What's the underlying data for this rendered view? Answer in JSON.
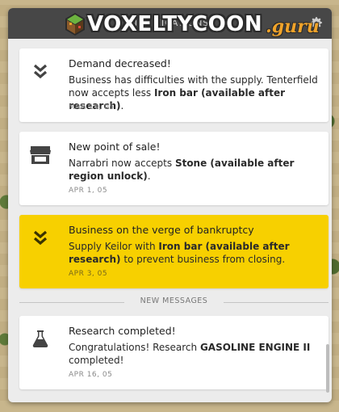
{
  "window": {
    "title": "NOTIFICATIONS",
    "settings_icon": "gear-icon"
  },
  "logo": {
    "main": "VOXELTYCOON",
    "suffix": ".guru"
  },
  "notifications": [
    {
      "icon": "double-chevron-down-icon",
      "heading": "Demand decreased!",
      "body_prefix": "Business has difficulties with the supply. Tenterfield now accepts less ",
      "body_bold": "Iron bar (available after research)",
      "body_suffix": ".",
      "date": "MAR 14, 05",
      "highlighted": false
    },
    {
      "icon": "store-icon",
      "heading": "New point of sale!",
      "body_prefix": "Narrabri now accepts ",
      "body_bold": "Stone (available after region unlock)",
      "body_suffix": ".",
      "date": "APR 1, 05",
      "highlighted": false
    },
    {
      "icon": "double-chevron-down-icon",
      "heading": "Business on the verge of bankruptcy",
      "body_prefix": "Supply Keilor with ",
      "body_bold": "Iron bar (available after research)",
      "body_suffix": " to prevent business from closing.",
      "date": "APR 3, 05",
      "highlighted": true
    }
  ],
  "separator_label": "NEW MESSAGES",
  "new_notifications": [
    {
      "icon": "flask-icon",
      "heading": "Research completed!",
      "body_prefix": "Congratulations! Research ",
      "body_bold": "GASOLINE ENGINE II",
      "body_suffix": " completed!",
      "date": "APR 16, 05",
      "highlighted": false
    }
  ],
  "colors": {
    "highlight": "#f7d000",
    "titlebar": "#474747",
    "panel": "#ececec"
  }
}
